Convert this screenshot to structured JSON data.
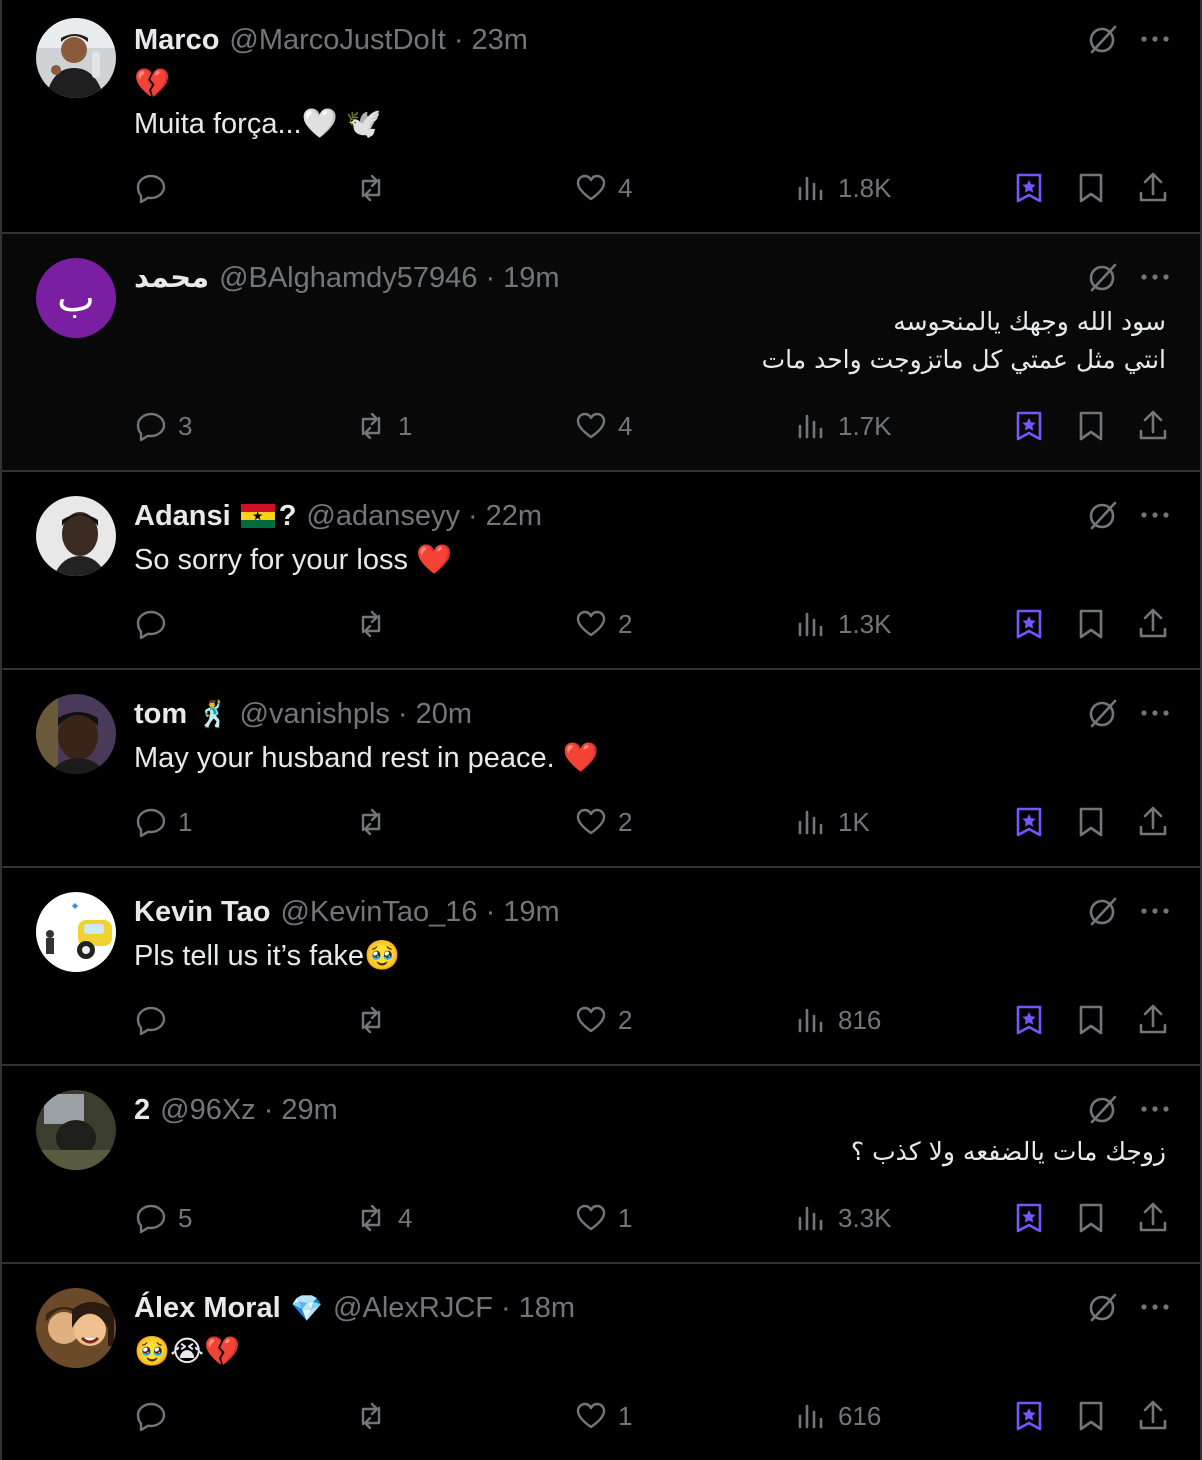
{
  "colors": {
    "background": "#000000",
    "text": "#e7e9ea",
    "muted": "#71767b",
    "accent": "#7856ff",
    "heart_red": "#f91880",
    "divider": "#2f3336"
  },
  "replies": [
    {
      "name": "Marco",
      "handle": "@MarcoJustDoIt",
      "sep": "·",
      "time": "23m",
      "lines": [
        "Muita força...🤍 🕊️"
      ],
      "lead_emoji": "💔",
      "replies": "",
      "reposts": "",
      "likes": "4",
      "views": "1.8K",
      "avatar": "photo-man-selfie"
    },
    {
      "name": "محمد",
      "handle": "@BAlghamdy57946",
      "sep": "·",
      "time": "19m",
      "lines": [
        "سود الله وجهك يالمنحوسه",
        "انتي مثل عمتي كل ماتزوجت واحد مات"
      ],
      "replies": "3",
      "reposts": "1",
      "likes": "4",
      "views": "1.7K",
      "avatar_letter": "ب"
    },
    {
      "name": "Adansi",
      "badge": "?",
      "handle": "@adanseyy",
      "sep": "·",
      "time": "22m",
      "lines": [
        "So sorry for your loss ❤️"
      ],
      "replies": "",
      "reposts": "",
      "likes": "2",
      "views": "1.3K",
      "avatar": "photo-man-profile"
    },
    {
      "name": "tom",
      "handle": "@vanishpls",
      "sep": "·",
      "time": "20m",
      "lines": [
        "May your husband rest in peace. ❤️"
      ],
      "name_emoji": "🕺",
      "replies": "1",
      "reposts": "",
      "likes": "2",
      "views": "1K",
      "avatar": "photo-man-portrait"
    },
    {
      "name": "Kevin Tao",
      "handle": "@KevinTao_16",
      "sep": "·",
      "time": "19m",
      "lines": [
        "Pls tell us it’s fake🥹"
      ],
      "replies": "",
      "reposts": "",
      "likes": "2",
      "views": "816",
      "avatar": "illustration-car"
    },
    {
      "name": "2",
      "handle": "@96Xz",
      "sep": "·",
      "time": "29m",
      "lines": [
        "زوجك مات يالضفعه ولا كذب ؟"
      ],
      "replies": "5",
      "reposts": "4",
      "likes": "1",
      "views": "3.3K",
      "avatar": "photo-dark"
    },
    {
      "name": "Álex Moral",
      "handle": "@AlexRJCF",
      "sep": "·",
      "time": "18m",
      "lines": [
        "🥹😭💔"
      ],
      "name_emoji": "💎",
      "replies": "",
      "reposts": "",
      "likes": "1",
      "views": "616",
      "avatar": "illustration-couple"
    }
  ]
}
